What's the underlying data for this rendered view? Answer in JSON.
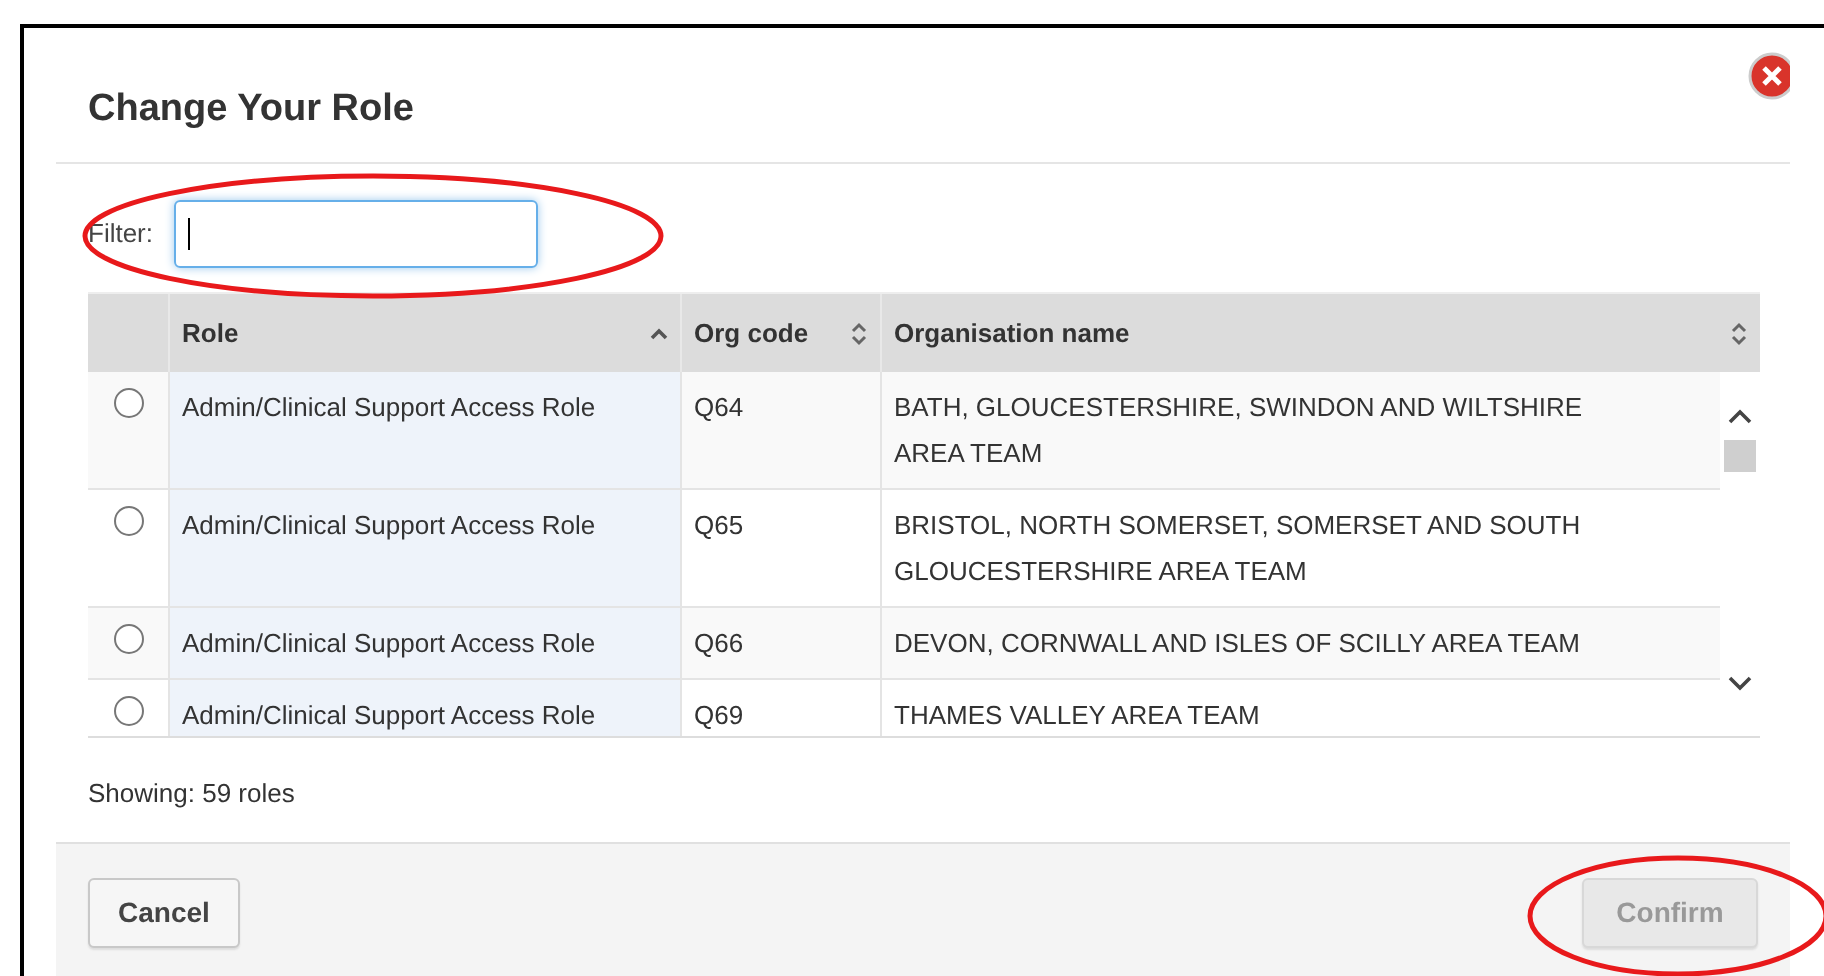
{
  "dialog": {
    "title": "Change Your Role"
  },
  "filter": {
    "label": "Filter:",
    "focused": true
  },
  "table": {
    "columns": [
      {
        "label": "Role",
        "sorted_ascending": true
      },
      {
        "label": "Org code",
        "sorted_ascending": false
      },
      {
        "label": "Organisation name",
        "sorted_ascending": false
      }
    ],
    "rows": [
      {
        "selected": false,
        "role": "Admin/Clinical Support Access Role",
        "org_code": "Q64",
        "org_name": "BATH, GLOUCESTERSHIRE, SWINDON AND WILTSHIRE AREA TEAM"
      },
      {
        "selected": false,
        "role": "Admin/Clinical Support Access Role",
        "org_code": "Q65",
        "org_name": "BRISTOL, NORTH SOMERSET, SOMERSET AND SOUTH GLOUCESTERSHIRE AREA TEAM"
      },
      {
        "selected": false,
        "role": "Admin/Clinical Support Access Role",
        "org_code": "Q66",
        "org_name": "DEVON, CORNWALL AND ISLES OF SCILLY AREA TEAM"
      },
      {
        "selected": false,
        "role": "Admin/Clinical Support Access Role",
        "org_code": "Q69",
        "org_name": "THAMES VALLEY AREA TEAM"
      }
    ]
  },
  "summary": "Showing: 59 roles",
  "buttons": [
    {
      "label": "Cancel",
      "disabled": false
    },
    {
      "label": "Confirm",
      "disabled": true
    }
  ]
}
